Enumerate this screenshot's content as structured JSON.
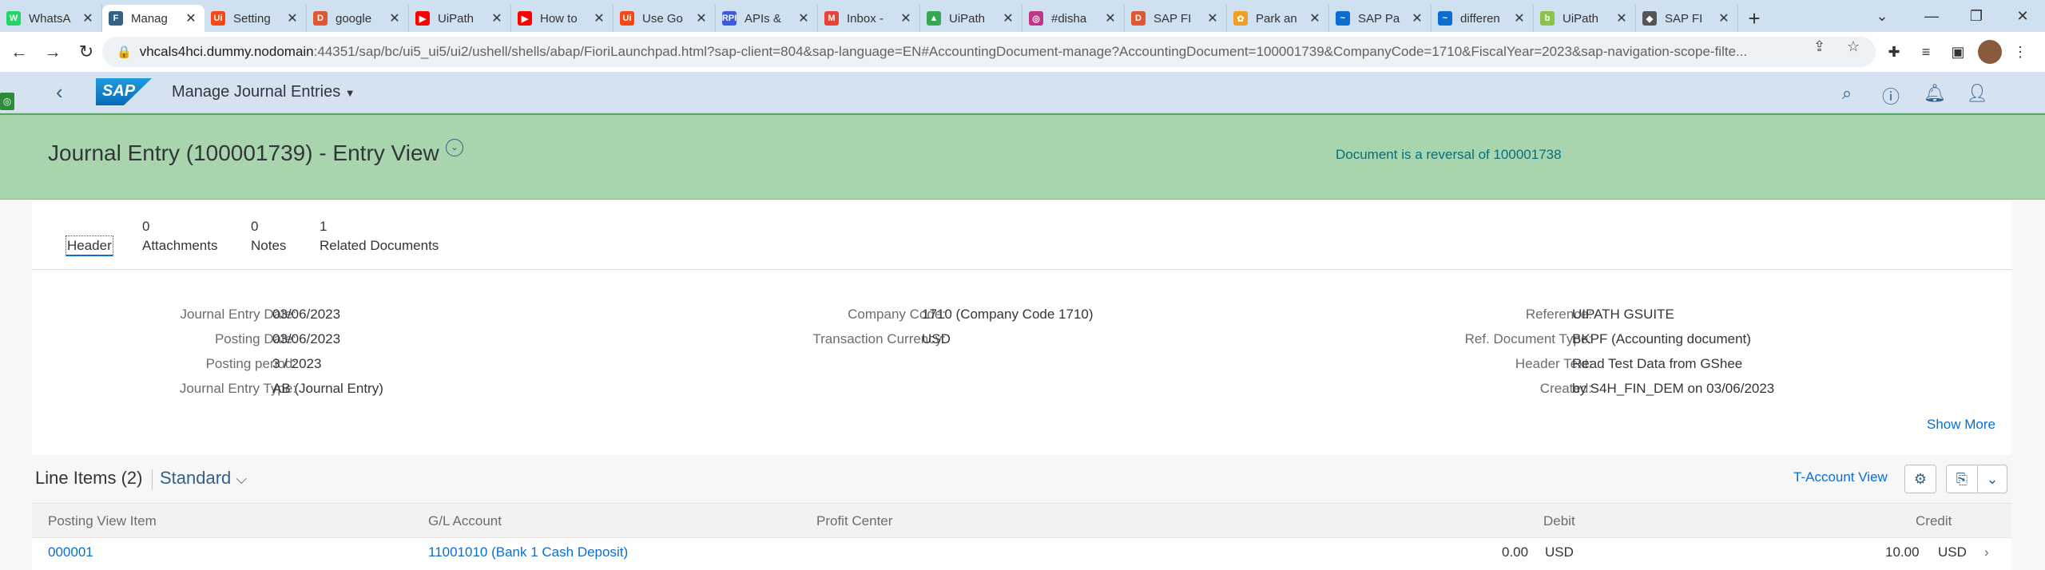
{
  "browser": {
    "tabs": [
      {
        "title": "WhatsA",
        "icon": "whatsapp-icon",
        "color": "#25d366",
        "glyph": "W"
      },
      {
        "title": "Manag",
        "icon": "fiori-icon",
        "color": "#346187",
        "glyph": "F"
      },
      {
        "title": "Setting",
        "icon": "uipath-icon",
        "color": "#fa4616",
        "glyph": "Ui"
      },
      {
        "title": "google",
        "icon": "duckduckgo-icon",
        "color": "#de5833",
        "glyph": "D"
      },
      {
        "title": "UiPath",
        "icon": "youtube-icon",
        "color": "#ff0000",
        "glyph": "▶"
      },
      {
        "title": "How to",
        "icon": "youtube-icon",
        "color": "#ff0000",
        "glyph": "▶"
      },
      {
        "title": "Use Go",
        "icon": "uipath-icon",
        "color": "#fa4616",
        "glyph": "Ui"
      },
      {
        "title": "APIs &",
        "icon": "rpi-icon",
        "color": "#3b5bdb",
        "glyph": "RPI"
      },
      {
        "title": "Inbox -",
        "icon": "gmail-icon",
        "color": "#ea4335",
        "glyph": "M"
      },
      {
        "title": "UiPath",
        "icon": "google-drive-icon",
        "color": "#34a853",
        "glyph": "▲"
      },
      {
        "title": "#disha",
        "icon": "instagram-icon",
        "color": "#c13584",
        "glyph": "◎"
      },
      {
        "title": "SAP FI",
        "icon": "duckduckgo-icon",
        "color": "#de5833",
        "glyph": "D"
      },
      {
        "title": "Park an",
        "icon": "sap-community-icon",
        "color": "#f0a01e",
        "glyph": "✿"
      },
      {
        "title": "SAP Pa",
        "icon": "sap-tab-icon",
        "color": "#0a6ed1",
        "glyph": "~"
      },
      {
        "title": "differen",
        "icon": "sap-tab-icon",
        "color": "#0a6ed1",
        "glyph": "~"
      },
      {
        "title": "UiPath",
        "icon": "uipath-forum-icon",
        "color": "#8bc34a",
        "glyph": "b"
      },
      {
        "title": "SAP FI",
        "icon": "sap-diamond-icon",
        "color": "#555555",
        "glyph": "◆"
      }
    ],
    "url_host": "vhcals4hci.dummy.nodomain",
    "url_path": ":44351/sap/bc/ui5_ui5/ui2/ushell/shells/abap/FioriLaunchpad.html?sap-client=804&sap-language=EN#AccountingDocument-manage?AccountingDocument=100001739&CompanyCode=1710&FiscalYear=2023&sap-navigation-scope-filte..."
  },
  "shell": {
    "logo_text": "SAP",
    "app_title": "Manage Journal Entries"
  },
  "header": {
    "title": "Journal Entry (100001739) - Entry View",
    "reversal_message": "Document is a reversal of 100001738"
  },
  "anchors": [
    {
      "count": "",
      "label": "Header"
    },
    {
      "count": "0",
      "label": "Attachments"
    },
    {
      "count": "0",
      "label": "Notes"
    },
    {
      "count": "1",
      "label": "Related Documents"
    }
  ],
  "fields": {
    "col1": [
      {
        "label": "Journal Entry Date:",
        "value": "03/06/2023"
      },
      {
        "label": "Posting Date:",
        "value": "03/06/2023"
      },
      {
        "label": "Posting period:",
        "value": "3 / 2023"
      },
      {
        "label": "Journal Entry Type:",
        "value": "AB (Journal Entry)"
      }
    ],
    "col2": [
      {
        "label": "Company Code:",
        "value": "1710 (Company Code 1710)"
      },
      {
        "label": "Transaction Currency:",
        "value": "USD"
      }
    ],
    "col3": [
      {
        "label": "Reference:",
        "value": "UIPATH GSUITE"
      },
      {
        "label": "Ref. Document Type:",
        "value": "BKPF (Accounting document)"
      },
      {
        "label": "Header Text:",
        "value": "Read Test Data from GShee"
      },
      {
        "label": "Created:",
        "value": "by S4H_FIN_DEM on 03/06/2023"
      }
    ]
  },
  "show_more": "Show More",
  "line_items": {
    "title": "Line Items (2)",
    "variant": "Standard",
    "t_account_view": "T-Account View",
    "columns": [
      "Posting View Item",
      "G/L Account",
      "Profit Center",
      "Debit",
      "Credit"
    ],
    "row1": {
      "item": "000001",
      "gl": "11001010 (Bank 1 Cash Deposit)",
      "debit": "0.00",
      "debit_cur": "USD",
      "credit": "10.00",
      "credit_cur": "USD"
    }
  }
}
